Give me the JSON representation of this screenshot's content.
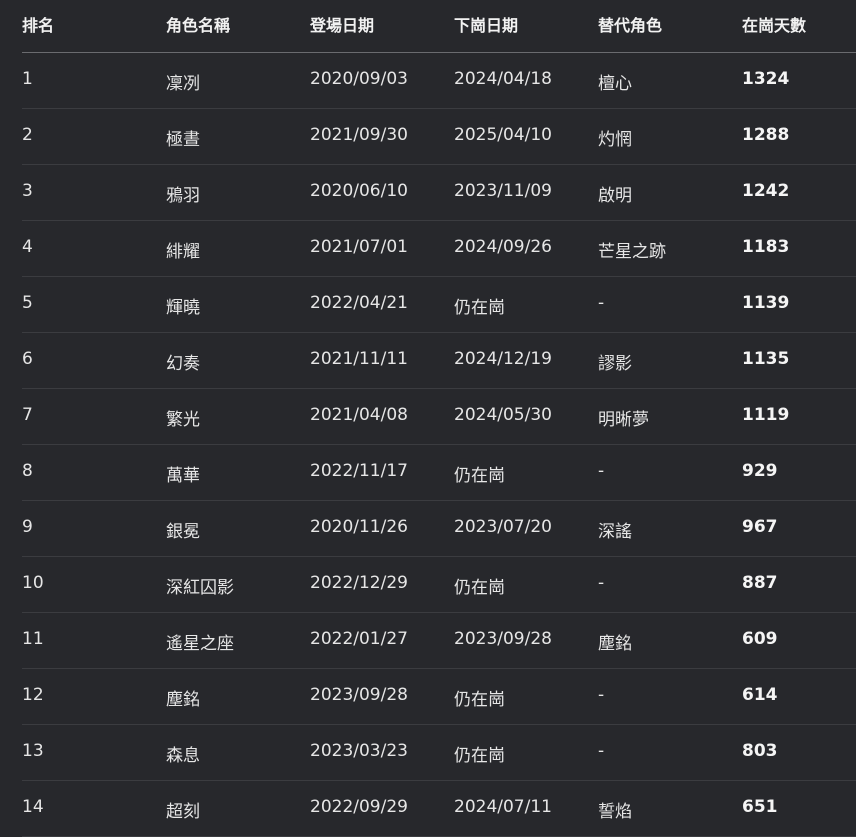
{
  "table": {
    "headers": [
      "排名",
      "角色名稱",
      "登場日期",
      "下崗日期",
      "替代角色",
      "在崗天數"
    ],
    "rows": [
      [
        "1",
        "凜冽",
        "2020/09/03",
        "2024/04/18",
        "檀心",
        "1324"
      ],
      [
        "2",
        "極晝",
        "2021/09/30",
        "2025/04/10",
        "灼惘",
        "1288"
      ],
      [
        "3",
        "鴉羽",
        "2020/06/10",
        "2023/11/09",
        "啟明",
        "1242"
      ],
      [
        "4",
        "緋耀",
        "2021/07/01",
        "2024/09/26",
        "芒星之跡",
        "1183"
      ],
      [
        "5",
        "輝曉",
        "2022/04/21",
        "仍在崗",
        "-",
        "1139"
      ],
      [
        "6",
        "幻奏",
        "2021/11/11",
        "2024/12/19",
        "謬影",
        "1135"
      ],
      [
        "7",
        "繁光",
        "2021/04/08",
        "2024/05/30",
        "明晰夢",
        "1119"
      ],
      [
        "8",
        "萬華",
        "2022/11/17",
        "仍在崗",
        "-",
        "929"
      ],
      [
        "9",
        "銀冕",
        "2020/11/26",
        "2023/07/20",
        "深謠",
        "967"
      ],
      [
        "10",
        "深紅囚影",
        "2022/12/29",
        "仍在崗",
        "-",
        "887"
      ],
      [
        "11",
        "遙星之座",
        "2022/01/27",
        "2023/09/28",
        "塵銘",
        "609"
      ],
      [
        "12",
        "塵銘",
        "2023/09/28",
        "仍在崗",
        "-",
        "614"
      ],
      [
        "13",
        "森息",
        "2023/03/23",
        "仍在崗",
        "-",
        "803"
      ],
      [
        "14",
        "超刻",
        "2022/09/29",
        "2024/07/11",
        "誓焰",
        "651"
      ]
    ]
  },
  "colors": {
    "background": "#27282c",
    "text": "#ececec",
    "header_divider": "#6a6b6f",
    "row_divider": "#3b3c40"
  }
}
